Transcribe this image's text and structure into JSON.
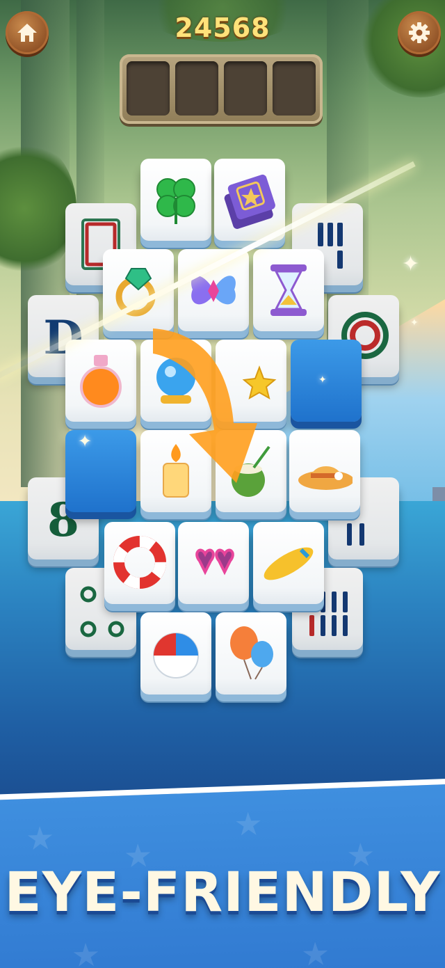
{
  "header": {
    "score": "24568",
    "home_icon": "home-icon",
    "settings_icon": "gear-icon",
    "slots": [
      1,
      2,
      3,
      4
    ]
  },
  "tiles": {
    "bottom_layer": [
      "card-red",
      "D",
      "8",
      "dots",
      "bamboo",
      "bamboo",
      "bamboo",
      "wheel-red"
    ],
    "icons": [
      "clover",
      "spellbook",
      "ring",
      "butterfly",
      "hourglass",
      "potion",
      "crystal-ball",
      "star",
      "candle",
      "coconut",
      "sun-hat",
      "life-ring",
      "heart-sunglasses",
      "surfboard",
      "beach-ball",
      "balloons"
    ],
    "mahjong_letters": {
      "d": "D",
      "eight": "8"
    }
  },
  "colors": {
    "tile_blue": "#2a86dc",
    "score_gold": "#ffe27a",
    "button_brown": "#a9662f",
    "banner_blue": "#2f77cf"
  },
  "slogan": "EYE-FRIENDLY"
}
